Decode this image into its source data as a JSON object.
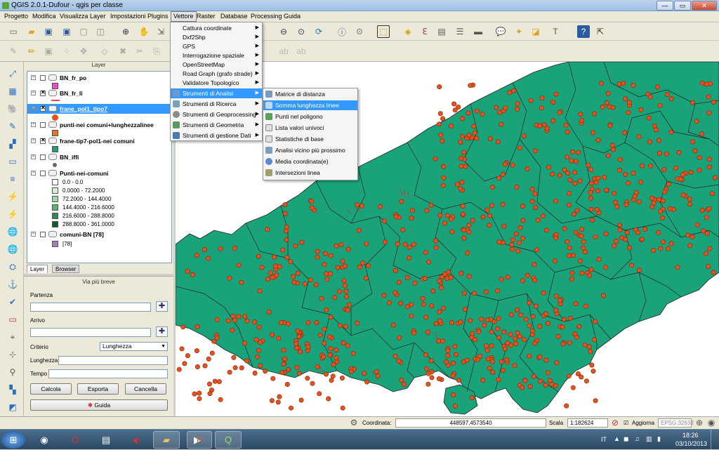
{
  "window": {
    "title": "QGIS 2.0.1-Dufour - qgis per classe",
    "minimize": "—",
    "maximize": "▭",
    "close": "✕"
  },
  "menubar": [
    "Progetto",
    "Modifica",
    "Visualizza",
    "Layer",
    "Impostazioni",
    "Plugins",
    "Vettore",
    "Raster",
    "Database",
    "Processing",
    "Guida"
  ],
  "vector_menu": {
    "items": [
      "Cattura coordinate",
      "Dxf2Shp",
      "GPS",
      "Interrogazione spaziale",
      "OpenStreetMap",
      "Road Graph (grafo strade)",
      "Validatore Topologico",
      "Strumenti di Analisi",
      "Strumenti di Ricerca",
      "Strumenti di Geoprocessing",
      "Strumenti di Geometria",
      "Strumenti di gestione Dati"
    ],
    "highlighted": "Strumenti di Analisi"
  },
  "analysis_submenu": {
    "items": [
      "Matrice di distanza",
      "Somma lunghezza linee",
      "Punti nel poligono",
      "Lista valori univoci",
      "Statistiche di base",
      "Analisi vicino più prossimo",
      "Media coordinata(e)",
      "Intersezioni linea"
    ],
    "highlighted": "Somma lunghezza linee"
  },
  "layer_panel": {
    "title": "Layer",
    "layers": [
      {
        "name": "BN_fr_po",
        "checked": false,
        "color": "#ff44cc"
      },
      {
        "name": "BN_fr_li",
        "checked": true,
        "color": "#ee4444"
      },
      {
        "name": "frane_pol1_tipo7",
        "checked": true,
        "color": "#e8501c",
        "selected": true
      },
      {
        "name": "punti-nei comuni+lunghezzalinee",
        "checked": false,
        "color": "#f0701c"
      },
      {
        "name": "frane-tip7-pol1-nei comuni",
        "checked": true,
        "color": "#1aa37a"
      },
      {
        "name": "BN_iffi",
        "checked": false,
        "color": "#666666"
      },
      {
        "name": "Punti-nei-comuni",
        "checked": false
      },
      {
        "name": "comuni-BN [78]",
        "checked": false,
        "color": "#b07ac0"
      }
    ],
    "legend": [
      {
        "label": "0.0 - 0.0",
        "color": "#f7fcf5"
      },
      {
        "label": "0.0000 - 72.2000",
        "color": "#d4efcf"
      },
      {
        "label": "72.2000 - 144.4000",
        "color": "#9ed89a"
      },
      {
        "label": "144.4000 - 216.6000",
        "color": "#58b56e"
      },
      {
        "label": "216.6000 - 288.8000",
        "color": "#2a8f4e"
      },
      {
        "label": "288.8000 - 361.0000",
        "color": "#0b5e2a"
      }
    ],
    "comuni_count": "[78]",
    "tabs": [
      "Layer",
      "Browser"
    ]
  },
  "route_panel": {
    "title": "Via più breve",
    "start_label": "Partenza",
    "end_label": "Arrivo",
    "criterion_label": "Criterio",
    "criterion_value": "Lunghezza",
    "length_label": "Lunghezza",
    "time_label": "Tempo",
    "calc": "Calcola",
    "export": "Esporta",
    "cancel": "Cancella",
    "help": "Guida"
  },
  "statusbar": {
    "coord_label": "Coordinata:",
    "coord_value": "448597,4573540",
    "scale_label": "Scala",
    "scale_value": "1:182624",
    "refresh": "Aggiorna",
    "epsg": "EPSG:32633"
  },
  "taskbar": {
    "lang": "IT",
    "time": "18:26",
    "date": "03/10/2013"
  },
  "colors": {
    "map_fill": "#1aa37a",
    "point": "#e8501c",
    "boundary": "#222222"
  }
}
